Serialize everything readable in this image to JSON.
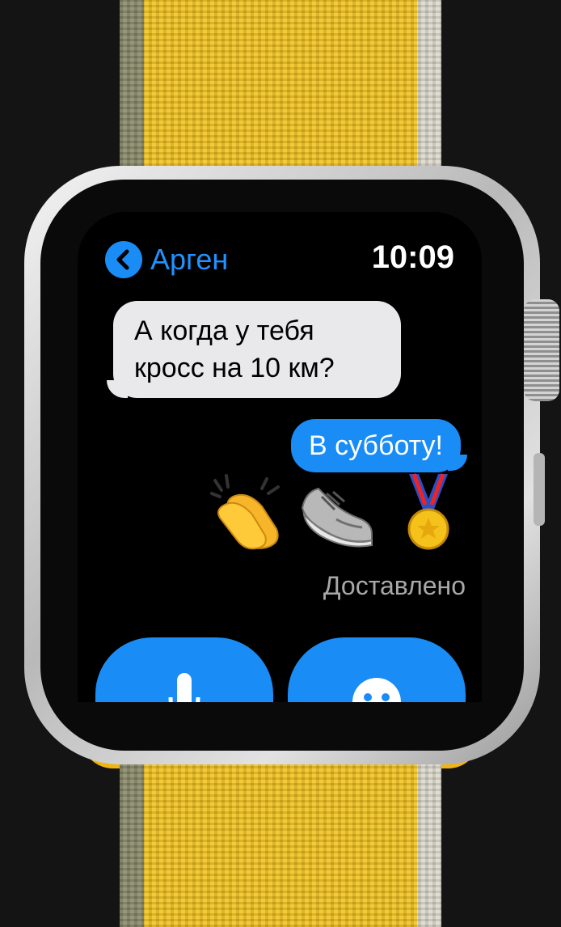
{
  "header": {
    "contact_name": "Арген",
    "time": "10:09"
  },
  "messages": {
    "incoming_line1": "А когда у тебя",
    "incoming_line2": "кросс на 10 км?",
    "outgoing": "В субботу!",
    "emojis": [
      "clapping-hands",
      "running-shoe",
      "sports-medal"
    ],
    "status": "Доставлено"
  },
  "actions": [
    {
      "icon": "microphone-icon"
    },
    {
      "icon": "emoji-icon"
    }
  ],
  "colors": {
    "accent": "#1a8cf5",
    "incoming_bubble": "#e9e9eb",
    "band": "#f2c421",
    "status_text": "#a8a8a8"
  }
}
